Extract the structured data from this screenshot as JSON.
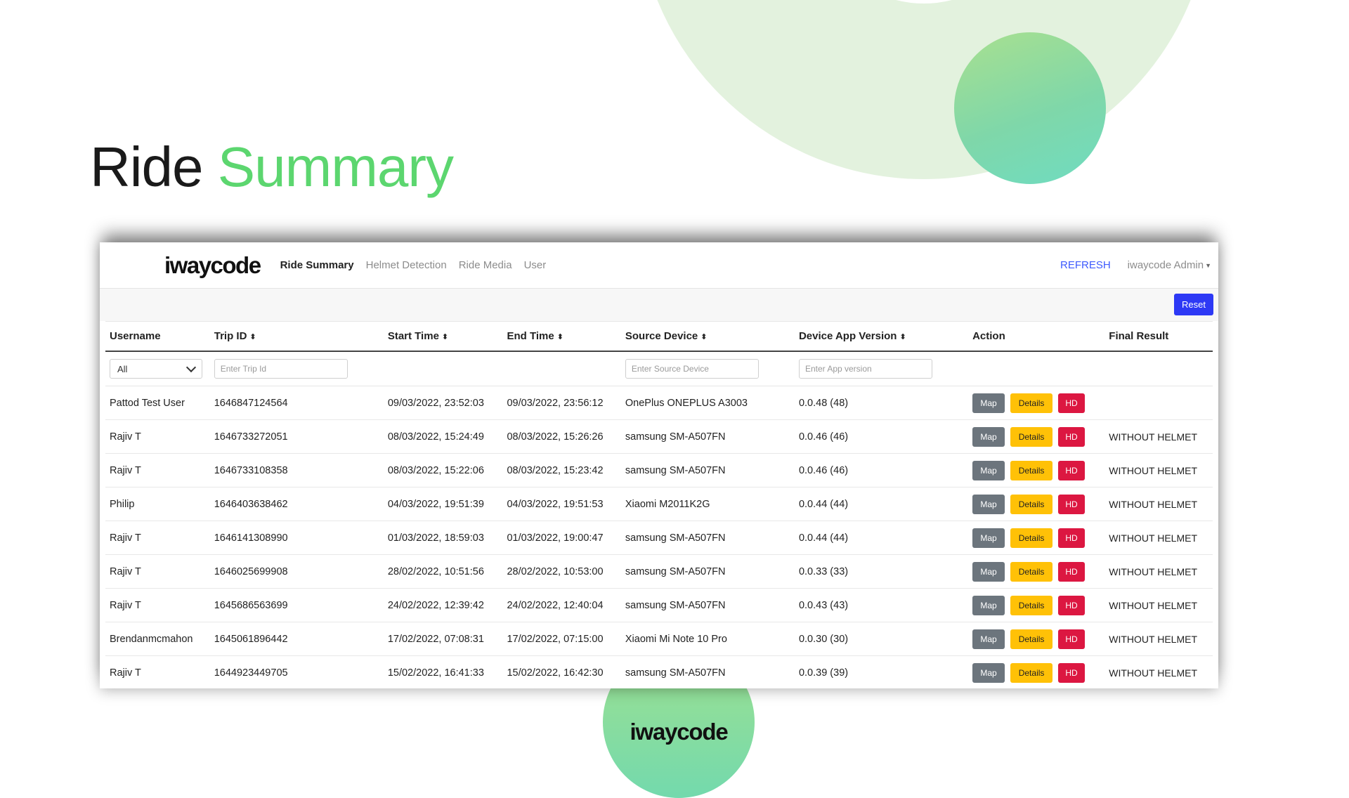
{
  "page": {
    "title_part1": "Ride",
    "title_part2": "Summary",
    "footer_brand": "iwaycode",
    "accent_color": "#5cd66f"
  },
  "navbar": {
    "brand": "iwaycode",
    "links": [
      "Ride Summary",
      "Helmet Detection",
      "Ride Media",
      "User"
    ],
    "active": "Ride Summary",
    "refresh": "REFRESH",
    "user_menu": "iwaycode Admin"
  },
  "toolbar": {
    "reset": "Reset"
  },
  "table": {
    "headers": [
      "Username",
      "Trip ID",
      "Start Time",
      "End Time",
      "Source Device",
      "Device App Version",
      "Action",
      "Final Result"
    ],
    "sortable": [
      false,
      true,
      true,
      true,
      true,
      true,
      false,
      false
    ],
    "filters": {
      "username_selected": "All",
      "trip_placeholder": "Enter Trip Id",
      "source_placeholder": "Enter Source Device",
      "version_placeholder": "Enter App version"
    },
    "action_labels": {
      "map": "Map",
      "details": "Details",
      "hd": "HD"
    },
    "rows": [
      {
        "username": "Pattod Test User",
        "trip_id": "1646847124564",
        "start": "09/03/2022, 23:52:03",
        "end": "09/03/2022, 23:56:12",
        "device": "OnePlus ONEPLUS A3003",
        "version": "0.0.48 (48)",
        "result": ""
      },
      {
        "username": "Rajiv T",
        "trip_id": "1646733272051",
        "start": "08/03/2022, 15:24:49",
        "end": "08/03/2022, 15:26:26",
        "device": "samsung SM-A507FN",
        "version": "0.0.46 (46)",
        "result": "WITHOUT HELMET"
      },
      {
        "username": "Rajiv T",
        "trip_id": "1646733108358",
        "start": "08/03/2022, 15:22:06",
        "end": "08/03/2022, 15:23:42",
        "device": "samsung SM-A507FN",
        "version": "0.0.46 (46)",
        "result": "WITHOUT HELMET"
      },
      {
        "username": "Philip",
        "trip_id": "1646403638462",
        "start": "04/03/2022, 19:51:39",
        "end": "04/03/2022, 19:51:53",
        "device": "Xiaomi M2011K2G",
        "version": "0.0.44 (44)",
        "result": "WITHOUT HELMET"
      },
      {
        "username": "Rajiv T",
        "trip_id": "1646141308990",
        "start": "01/03/2022, 18:59:03",
        "end": "01/03/2022, 19:00:47",
        "device": "samsung SM-A507FN",
        "version": "0.0.44 (44)",
        "result": "WITHOUT HELMET"
      },
      {
        "username": "Rajiv T",
        "trip_id": "1646025699908",
        "start": "28/02/2022, 10:51:56",
        "end": "28/02/2022, 10:53:00",
        "device": "samsung SM-A507FN",
        "version": "0.0.33 (33)",
        "result": "WITHOUT HELMET"
      },
      {
        "username": "Rajiv T",
        "trip_id": "1645686563699",
        "start": "24/02/2022, 12:39:42",
        "end": "24/02/2022, 12:40:04",
        "device": "samsung SM-A507FN",
        "version": "0.0.43 (43)",
        "result": "WITHOUT HELMET"
      },
      {
        "username": "Brendanmcmahon",
        "trip_id": "1645061896442",
        "start": "17/02/2022, 07:08:31",
        "end": "17/02/2022, 07:15:00",
        "device": "Xiaomi Mi Note 10 Pro",
        "version": "0.0.30 (30)",
        "result": "WITHOUT HELMET"
      },
      {
        "username": "Rajiv T",
        "trip_id": "1644923449705",
        "start": "15/02/2022, 16:41:33",
        "end": "15/02/2022, 16:42:30",
        "device": "samsung SM-A507FN",
        "version": "0.0.39 (39)",
        "result": "WITHOUT HELMET"
      }
    ]
  }
}
